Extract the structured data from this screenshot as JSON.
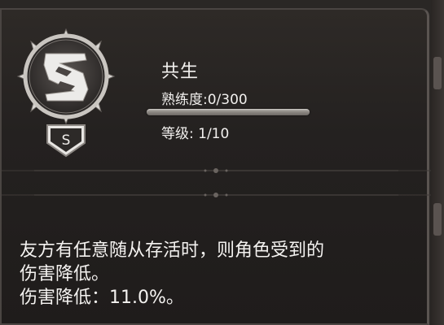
{
  "skill": {
    "name": "共生",
    "rank_letter": "S",
    "proficiency_text": "熟练度:0/300",
    "proficiency_fraction": 0,
    "level_text": "等级: 1/10"
  },
  "description": {
    "line1": "友方有任意随从存活时，则角色受到的",
    "line2": "伤害降低。",
    "line3": "伤害降低：11.0%。"
  },
  "icons": {
    "emblem": "symbiosis-skill-icon",
    "rank_badge": "rank-s-shield-icon"
  }
}
